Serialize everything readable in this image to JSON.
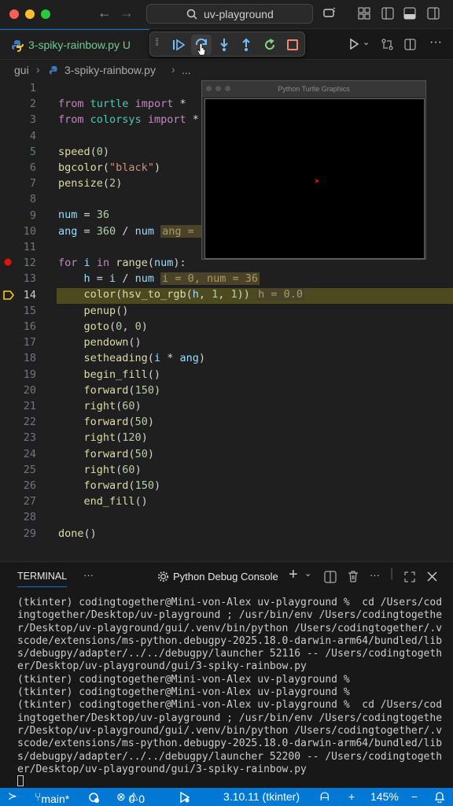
{
  "window": {
    "search_text": "uv-playground"
  },
  "tab": {
    "filename": "3-spiky-rainbow.py",
    "status": "U"
  },
  "breadcrumb": {
    "folder": "gui",
    "file": "3-spiky-rainbow.py",
    "more": "..."
  },
  "turtle_window": {
    "title": "Python Turtle Graphics"
  },
  "editor": {
    "current_line": 14,
    "breakpoint_line": 12,
    "lines": [
      {
        "n": "1"
      },
      {
        "n": "2"
      },
      {
        "n": "3"
      },
      {
        "n": "4"
      },
      {
        "n": "5"
      },
      {
        "n": "6"
      },
      {
        "n": "7"
      },
      {
        "n": "8"
      },
      {
        "n": "9"
      },
      {
        "n": "10"
      },
      {
        "n": "11"
      },
      {
        "n": "12"
      },
      {
        "n": "13"
      },
      {
        "n": "14"
      },
      {
        "n": "15"
      },
      {
        "n": "16"
      },
      {
        "n": "17"
      },
      {
        "n": "18"
      },
      {
        "n": "19"
      },
      {
        "n": "20"
      },
      {
        "n": "21"
      },
      {
        "n": "22"
      },
      {
        "n": "23"
      },
      {
        "n": "24"
      },
      {
        "n": "25"
      },
      {
        "n": "26"
      },
      {
        "n": "27"
      },
      {
        "n": "28"
      },
      {
        "n": "29"
      }
    ],
    "inline_values": {
      "l10": "ang = 1",
      "l13": "i = 0, num = 36",
      "l14": "h = 0.0"
    }
  },
  "panel": {
    "terminal_tab": "TERMINAL",
    "more": "···",
    "console_label": "Python Debug Console",
    "terminal_lines": [
      "(tkinter) codingtogether@Mini-von-Alex uv-playground %  cd /Users/cod",
      "ingtogether/Desktop/uv-playground ; /usr/bin/env /Users/codingtogethe",
      "r/Desktop/uv-playground/gui/.venv/bin/python /Users/codingtogether/.v",
      "scode/extensions/ms-python.debugpy-2025.18.0-darwin-arm64/bundled/lib",
      "s/debugpy/adapter/../../debugpy/launcher 52116 -- /Users/codingtogeth",
      "er/Desktop/uv-playground/gui/3-spiky-rainbow.py",
      "(tkinter) codingtogether@Mini-von-Alex uv-playground %",
      "(tkinter) codingtogether@Mini-von-Alex uv-playground %",
      "(tkinter) codingtogether@Mini-von-Alex uv-playground %  cd /Users/cod",
      "ingtogether/Desktop/uv-playground ; /usr/bin/env /Users/codingtogethe",
      "r/Desktop/uv-playground/gui/.venv/bin/python /Users/codingtogether/.v",
      "scode/extensions/ms-python.debugpy-2025.18.0-darwin-arm64/bundled/lib",
      "s/debugpy/adapter/../../debugpy/launcher 52200 -- /Users/codingtogeth",
      "er/Desktop/uv-playground/gui/3-spiky-rainbow.py"
    ]
  },
  "statusbar": {
    "branch": "main*",
    "errors": "0",
    "warnings": "0",
    "python": "3.10.11 (tkinter)",
    "plus": "+",
    "zoom": "145%"
  },
  "colors": {
    "accent": "#0078d4",
    "breakpoint": "#e51400",
    "current_line": "#4d4a1f",
    "debug_arrow": "#ffcc00"
  },
  "icons": [
    "search-icon",
    "back-arrow-icon",
    "forward-arrow-icon",
    "copilot-icon",
    "layout-icon",
    "sidebar-left-icon",
    "panel-bottom-icon",
    "sidebar-right-icon",
    "python-file-icon",
    "drag-handle-icon",
    "continue-icon",
    "step-over-icon",
    "step-into-icon",
    "step-out-icon",
    "restart-icon",
    "stop-icon",
    "run-icon",
    "compare-icon",
    "split-editor-icon",
    "more-icon",
    "gear-icon",
    "plus-icon",
    "trash-icon",
    "maximize-icon",
    "close-icon",
    "remote-icon",
    "branch-icon",
    "sync-icon",
    "error-icon",
    "warning-icon",
    "debug-icon",
    "bell-icon"
  ]
}
